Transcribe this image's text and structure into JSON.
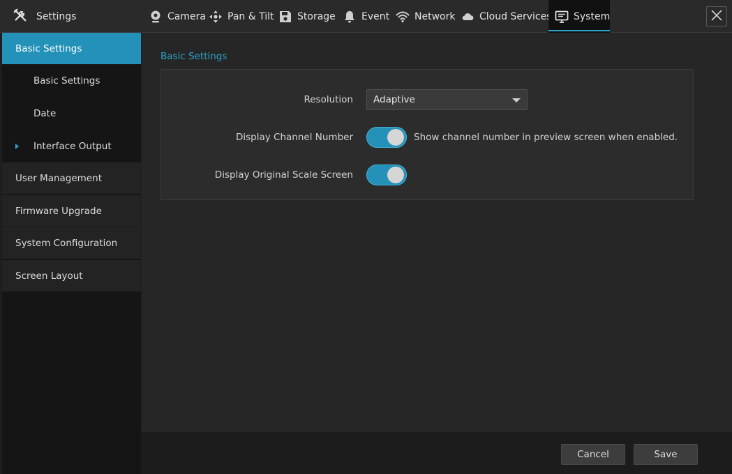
{
  "app": {
    "title": "Settings",
    "icon": "tools-icon"
  },
  "tabs": [
    {
      "label": "Camera",
      "icon": "camera-icon"
    },
    {
      "label": "Pan & Tilt",
      "icon": "pan-tilt-icon"
    },
    {
      "label": "Storage",
      "icon": "floppy-disk-icon"
    },
    {
      "label": "Event",
      "icon": "bell-icon"
    },
    {
      "label": "Network",
      "icon": "wifi-icon"
    },
    {
      "label": "Cloud Services",
      "icon": "cloud-icon"
    },
    {
      "label": "System",
      "icon": "monitor-icon",
      "active": true
    }
  ],
  "sidebar": {
    "items": [
      {
        "label": "Basic Settings",
        "active": true
      },
      {
        "label": "Basic Settings",
        "sub": true
      },
      {
        "label": "Date",
        "sub": true
      },
      {
        "label": "Interface Output",
        "sub": true,
        "expandable": true
      },
      {
        "label": "User Management"
      },
      {
        "label": "Firmware Upgrade"
      },
      {
        "label": "System Configuration"
      },
      {
        "label": "Screen Layout"
      }
    ]
  },
  "main": {
    "section_title": "Basic Settings",
    "resolution": {
      "label": "Resolution",
      "value": "Adaptive"
    },
    "display_channel_number": {
      "label": "Display Channel Number",
      "enabled": true,
      "hint": "Show channel number in preview screen when enabled."
    },
    "display_original_scale": {
      "label": "Display Original Scale Screen",
      "enabled": true
    }
  },
  "footer": {
    "cancel_label": "Cancel",
    "save_label": "Save"
  },
  "colors": {
    "accent": "#2391b8",
    "accent_text": "#2aa3c9",
    "background": "#1e1e1e"
  }
}
